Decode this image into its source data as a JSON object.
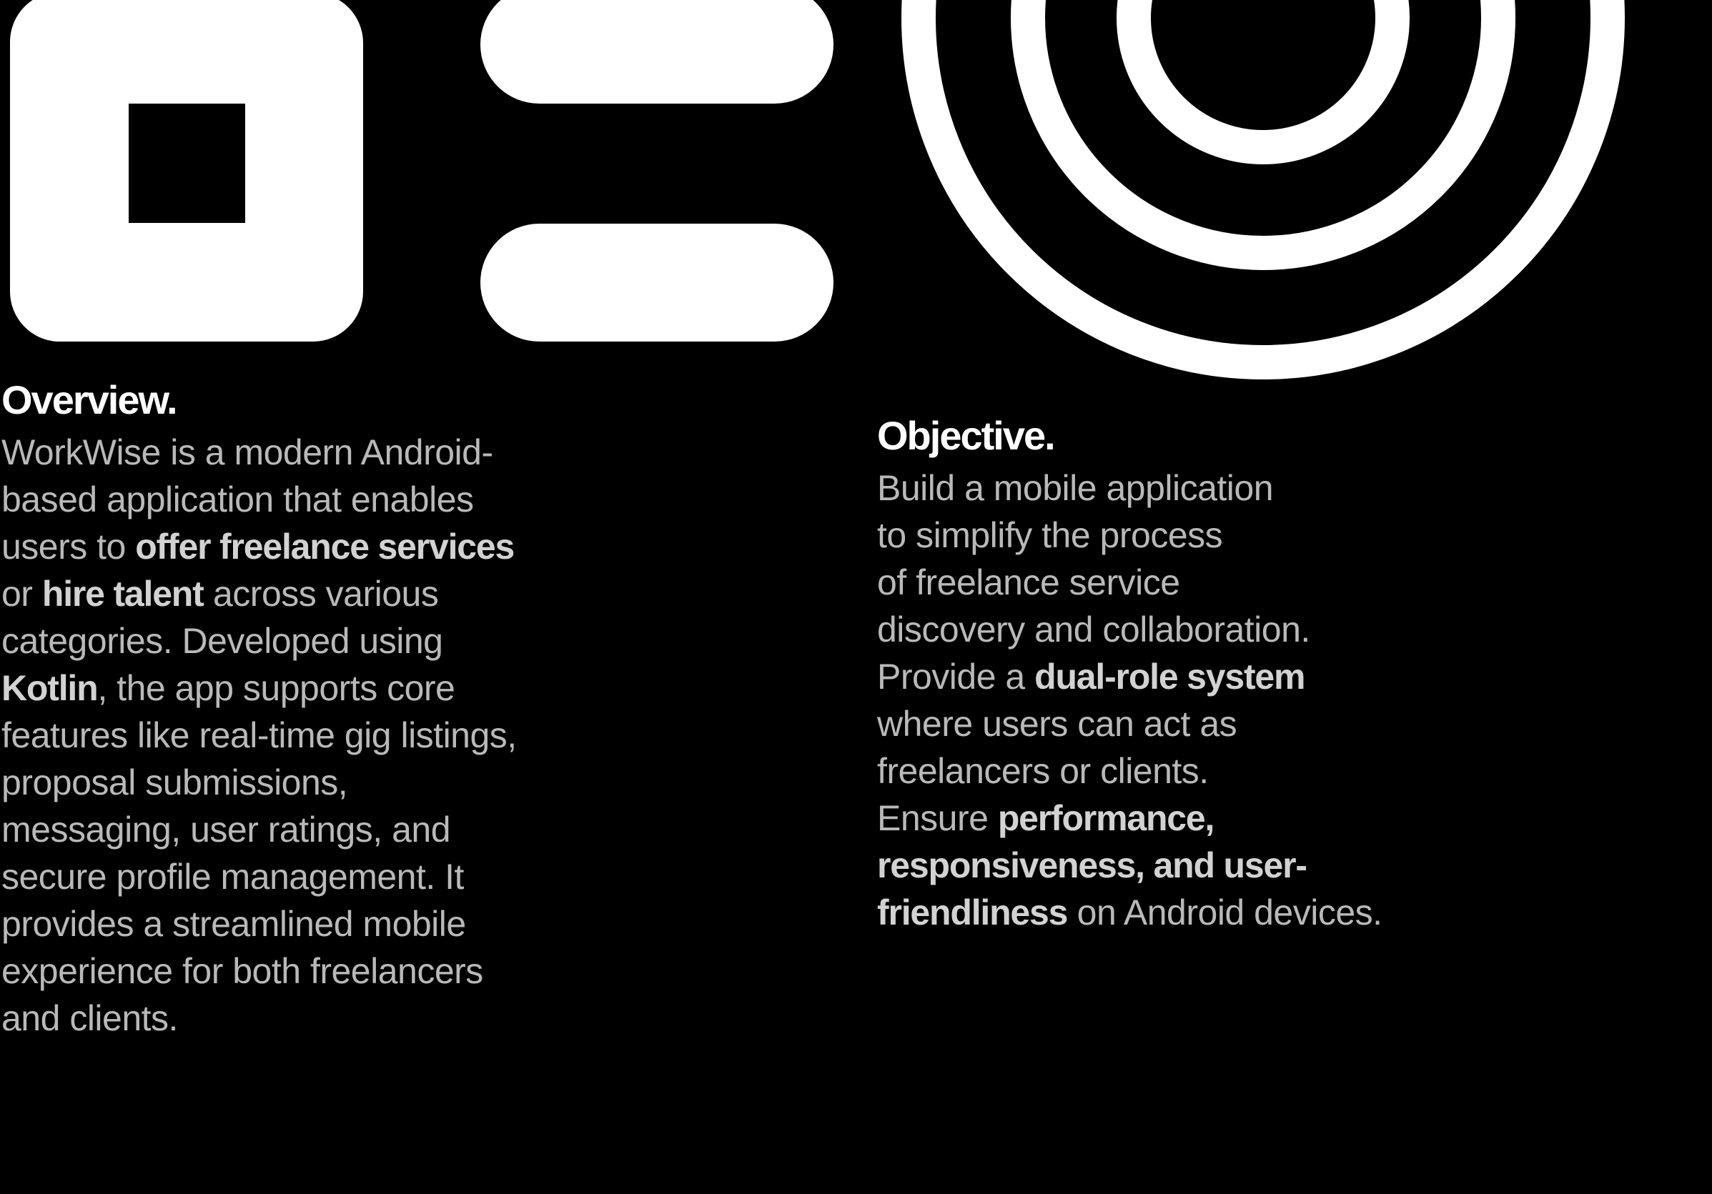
{
  "colors": {
    "background": "#000000",
    "shapes": "#ffffff",
    "heading": "#ffffff",
    "body_text": "#b9b9b9",
    "emphasis_text": "#d2d2d2"
  },
  "graphics": {
    "shapes": [
      "square-frame-shape",
      "pill-shape",
      "pill-shape",
      "concentric-rings-shape"
    ]
  },
  "overview": {
    "heading": "Overview.",
    "lines": [
      [
        {
          "text": "WorkWise is a modern Android-"
        }
      ],
      [
        {
          "text": "based application that enables"
        }
      ],
      [
        {
          "text": "users to "
        },
        {
          "text": "offer freelance services",
          "bold": true
        }
      ],
      [
        {
          "text": "or "
        },
        {
          "text": "hire talent",
          "bold": true
        },
        {
          "text": " across various"
        }
      ],
      [
        {
          "text": "categories. Developed using"
        }
      ],
      [
        {
          "text": "Kotlin",
          "bold": true
        },
        {
          "text": ", the app supports core"
        }
      ],
      [
        {
          "text": "features like real-time gig listings,"
        }
      ],
      [
        {
          "text": "proposal submissions,"
        }
      ],
      [
        {
          "text": "messaging, user ratings, and"
        }
      ],
      [
        {
          "text": "secure profile management. It"
        }
      ],
      [
        {
          "text": "provides a streamlined mobile"
        }
      ],
      [
        {
          "text": "experience for both freelancers"
        }
      ],
      [
        {
          "text": "and clients."
        }
      ]
    ]
  },
  "objective": {
    "heading": "Objective.",
    "lines": [
      [
        {
          "text": "Build a mobile application"
        }
      ],
      [
        {
          "text": "to simplify the process"
        }
      ],
      [
        {
          "text": "of freelance service"
        }
      ],
      [
        {
          "text": "discovery and collaboration."
        }
      ],
      [
        {
          "text": "Provide a "
        },
        {
          "text": "dual-role system",
          "bold": true
        }
      ],
      [
        {
          "text": "where users can act as"
        }
      ],
      [
        {
          "text": "freelancers or clients."
        }
      ],
      [
        {
          "text": "Ensure "
        },
        {
          "text": "performance,",
          "bold": true
        }
      ],
      [
        {
          "text": "responsiveness, and user-",
          "bold": true
        }
      ],
      [
        {
          "text": "friendliness",
          "bold": true
        },
        {
          "text": " on Android devices."
        }
      ]
    ]
  }
}
